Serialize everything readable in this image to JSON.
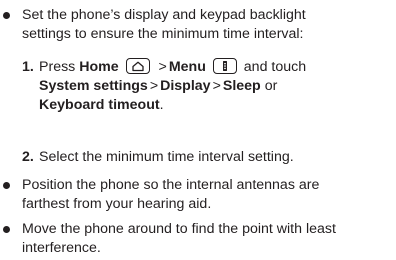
{
  "bullets": [
    {
      "text_line1": "Set the phone’s display and keypad backlight",
      "text_line2": "settings to ensure the minimum time interval:"
    },
    {
      "text_line1": "Position the phone so the internal antennas are",
      "text_line2": "farthest from your hearing aid."
    },
    {
      "text_line1": "Move the phone around to find the point with least",
      "text_line2": "interference."
    }
  ],
  "steps": [
    {
      "number": "1.",
      "press": "Press",
      "home": "Home",
      "gt": ">",
      "menu": "Menu",
      "and_touch": "and touch",
      "system_settings": "System settings",
      "display": "Display",
      "sleep": "Sleep",
      "or": "or",
      "keyboard_timeout": "Keyboard timeout",
      "period": "."
    },
    {
      "number": "2.",
      "text": "Select the minimum time interval setting."
    }
  ],
  "icons": {
    "home_key": "home-key-icon",
    "menu_key": "menu-key-icon"
  },
  "colors": {
    "text": "#231f20"
  }
}
